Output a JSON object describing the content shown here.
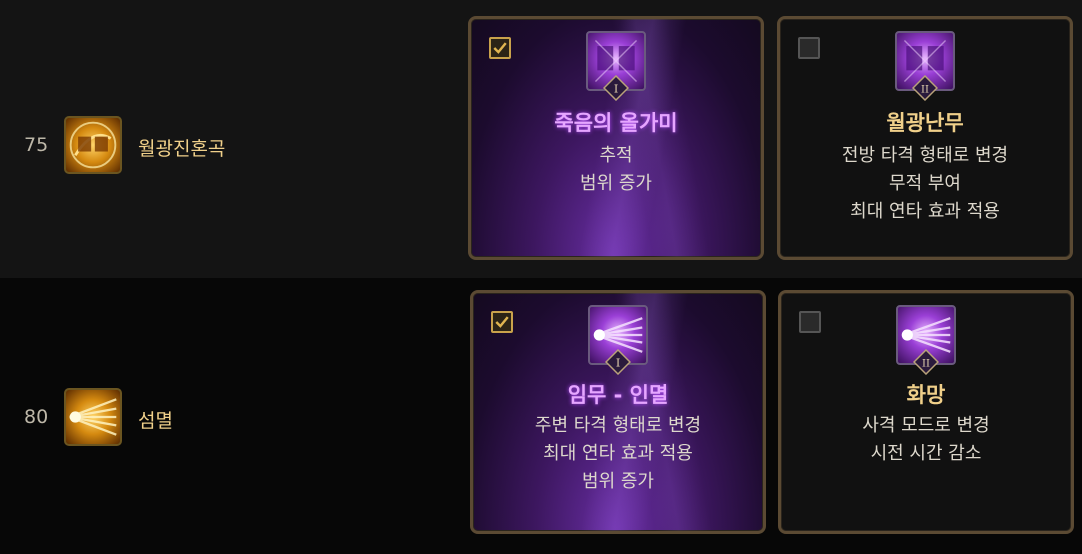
{
  "rows": [
    {
      "level": "75",
      "skill_name": "월광진혼곡",
      "skill_icon": "moon-requiem-icon",
      "options": [
        {
          "selected": true,
          "numeral": "I",
          "title": "죽음의 올가미",
          "lines": [
            "추적",
            "범위 증가"
          ]
        },
        {
          "selected": false,
          "numeral": "II",
          "title": "월광난무",
          "lines": [
            "전방 타격 형태로 변경",
            "무적 부여",
            "최대 연타 효과 적용"
          ]
        }
      ]
    },
    {
      "level": "80",
      "skill_name": "섬멸",
      "skill_icon": "annihilation-icon",
      "options": [
        {
          "selected": true,
          "numeral": "I",
          "title": "임무 - 인멸",
          "lines": [
            "주변 타격 형태로 변경",
            "최대 연타 효과 적용",
            "범위 증가"
          ]
        },
        {
          "selected": false,
          "numeral": "II",
          "title": "화망",
          "lines": [
            "사격 모드로 변경",
            "시전 시간 감소"
          ]
        }
      ]
    }
  ],
  "colors": {
    "selected_title": "#e6a6ff",
    "unselected_title": "#f0d08a",
    "card_border": "#5b4a33",
    "checkbox_gold": "#c9a24b"
  }
}
